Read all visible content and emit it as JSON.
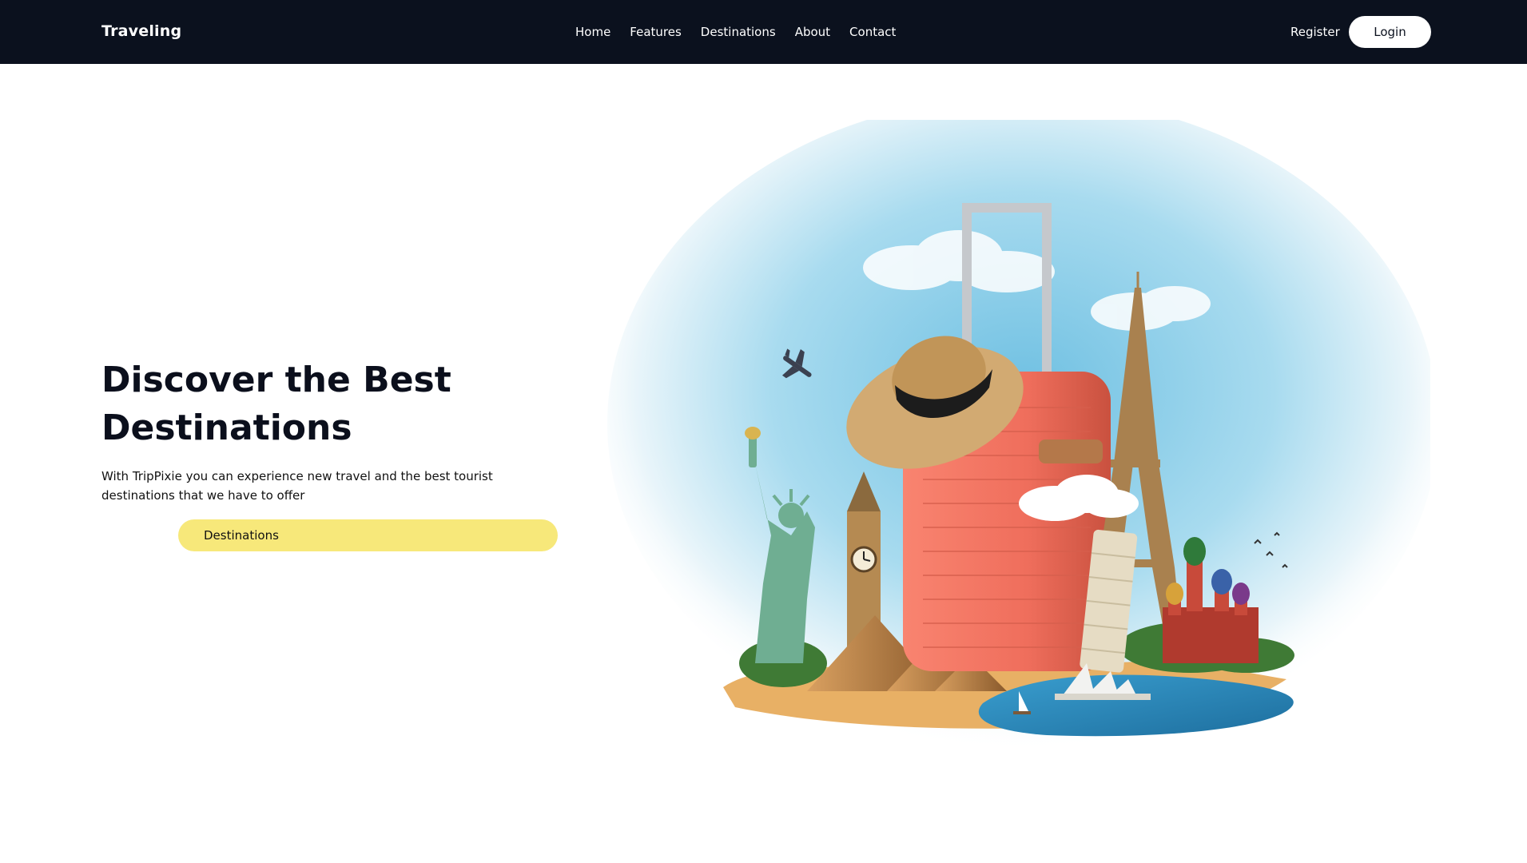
{
  "nav": {
    "brand": "Traveling",
    "links": [
      "Home",
      "Features",
      "Destinations",
      "About",
      "Contact"
    ],
    "register": "Register",
    "login": "Login"
  },
  "hero": {
    "title_line1": "Discover the Best",
    "title_line2": "Destinations",
    "description": "With TripPixie you can experience new travel and the best tourist destinations that we have to offer",
    "cta": "Destinations"
  },
  "colors": {
    "navbar_bg": "#0b111e",
    "cta_bg": "#f7e87a",
    "suitcase": "#ef6e5c",
    "sky": "#7fc8e6",
    "sand": "#e8b065"
  }
}
